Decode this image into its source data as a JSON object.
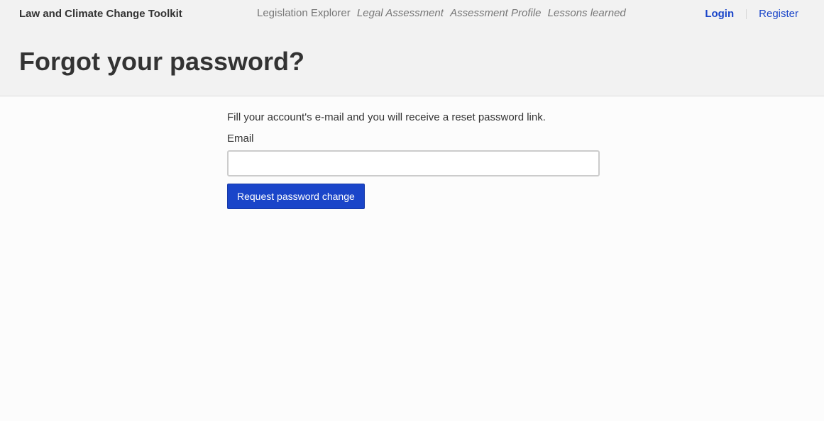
{
  "header": {
    "brand": "Law and Climate Change Toolkit",
    "nav": [
      {
        "label": "Legislation Explorer",
        "italic": false
      },
      {
        "label": "Legal Assessment",
        "italic": true
      },
      {
        "label": "Assessment Profile",
        "italic": true
      },
      {
        "label": "Lessons learned",
        "italic": true
      }
    ],
    "user_nav": {
      "login_label": "Login",
      "register_label": "Register"
    },
    "page_title": "Forgot your password?"
  },
  "form": {
    "intro": "Fill your account's e-mail and you will receive a reset password link.",
    "email_label": "Email",
    "email_value": "",
    "email_placeholder": "",
    "submit_label": "Request password change"
  },
  "colors": {
    "accent": "#1a45c9",
    "header_bg": "#f2f2f2",
    "page_bg": "#fcfcfc",
    "nav_text": "#767676",
    "text": "#333333"
  }
}
